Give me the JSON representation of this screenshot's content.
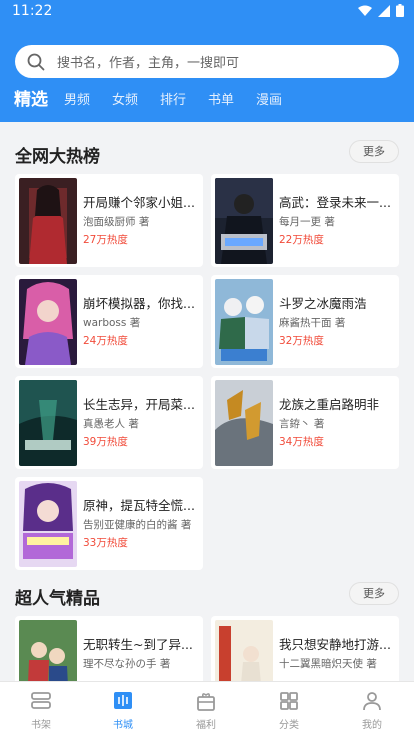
{
  "status_bar": {
    "time": "11:22"
  },
  "search": {
    "placeholder": "搜书名，作者，主角，一搜即可",
    "icon": "search-icon"
  },
  "tabs": [
    {
      "label": "精选",
      "active": true
    },
    {
      "label": "男频"
    },
    {
      "label": "女频"
    },
    {
      "label": "排行"
    },
    {
      "label": "书单"
    },
    {
      "label": "漫画"
    }
  ],
  "sections": [
    {
      "title": "全网大热榜",
      "more_label": "更多",
      "books": [
        {
          "title": "开局赚个邻家小姐...",
          "author": "泡面级厨师 著",
          "heat": "27万热度"
        },
        {
          "title": "高武：登录未来一...",
          "author": "每月一更 著",
          "heat": "22万热度"
        },
        {
          "title": "崩坏模拟器，你找...",
          "author": "warboss 著",
          "heat": "24万热度"
        },
        {
          "title": "斗罗之冰魔雨浩",
          "author": "麻酱热干面 著",
          "heat": "32万热度"
        },
        {
          "title": "长生志异，开局菜...",
          "author": "真愚老人 著",
          "heat": "39万热度"
        },
        {
          "title": "龙族之重启路明非",
          "author": "言銌丶 著",
          "heat": "34万热度"
        },
        {
          "title": "原神，提瓦特全慌...",
          "author": "告别亚健康的白的酱 著",
          "heat": "33万热度"
        }
      ]
    },
    {
      "title": "超人气精品",
      "more_label": "更多",
      "books": [
        {
          "title": "无职转生~到了异...",
          "author": "理不尽な孙の手 著",
          "heat": ""
        },
        {
          "title": "我只想安静地打游...",
          "author": "十二翼黑暗炽天使 著",
          "heat": ""
        }
      ]
    }
  ],
  "bottom_nav": [
    {
      "label": "书架",
      "icon": "bookshelf-icon"
    },
    {
      "label": "书城",
      "icon": "bookstore-icon",
      "active": true
    },
    {
      "label": "福利",
      "icon": "gift-icon"
    },
    {
      "label": "分类",
      "icon": "category-grid-icon"
    },
    {
      "label": "我的",
      "icon": "profile-icon"
    }
  ],
  "colors": {
    "brand": "#2f8ff5",
    "heat": "#f14b3a"
  }
}
